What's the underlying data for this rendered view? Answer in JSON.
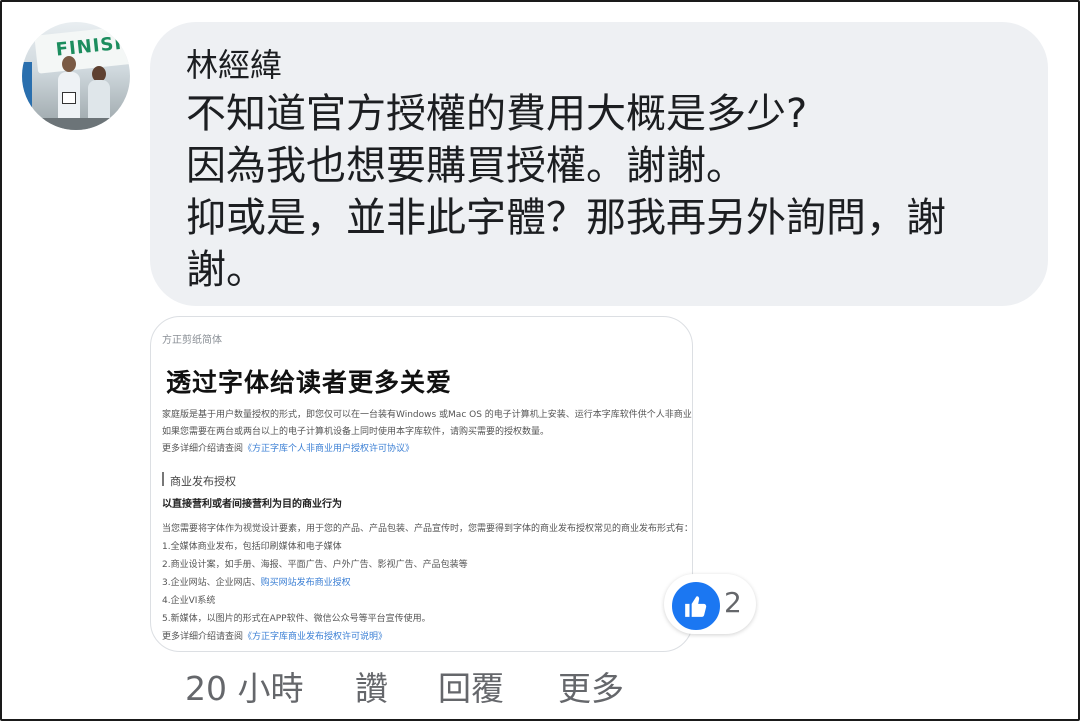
{
  "comment": {
    "author": "林經緯",
    "lines": [
      "不知道官方授權的費用大概是多少?",
      "因為我也想要購買授權。謝謝。",
      "抑或是，並非此字體？那我再另外詢問，謝",
      "謝。"
    ]
  },
  "avatar": {
    "banner_text": "FINISH"
  },
  "attachment": {
    "font_name": "方正剪纸简体",
    "headline": "透过字体给读者更多关爱",
    "paragraphs": [
      "家庭版是基于用户数量授权的形式，即您仅可以在一台装有Windows 或Mac OS 的电子计算机上安装、运行本字库软件供个人非商业使用。",
      "如果您需要在两台或两台以上的电子计算机设备上同时使用本字库软件，请购买需要的授权数量。"
    ],
    "more_prefix_1": "更多详细介绍请查阅",
    "more_link_1": "《方正字库个人非商业用户授权许可协议》",
    "section_title": "商业发布授权",
    "section_subtitle": "以直接营利或者间接营利为目的商业行为",
    "section_intro": "当您需要将字体作为视觉设计要素，用于您的产品、产品包装、产品宣传时，您需要得到字体的商业发布授权常见的商业发布形式有：",
    "items": [
      {
        "text": "1.全媒体商业发布，包括印刷媒体和电子媒体",
        "link": ""
      },
      {
        "text": "2.商业设计案，如手册、海报、平面广告、户外广告、影视广告、产品包装等",
        "link": ""
      },
      {
        "text": "3.企业网站、企业网店、",
        "link": "购买网站发布商业授权"
      },
      {
        "text": "4.企业VI系统",
        "link": ""
      },
      {
        "text": "5.新媒体，以图片的形式在APP软件、微信公众号等平台宣传使用。",
        "link": ""
      }
    ],
    "more_prefix_2": "更多详细介绍请查阅",
    "more_link_2": "《方正字库商业发布授权许可说明》"
  },
  "reactions": {
    "icon": "thumbs-up-icon",
    "count": "2",
    "color": "#1b77f2"
  },
  "actions": {
    "time": "20 小時",
    "like": "讚",
    "reply": "回覆",
    "more": "更多"
  }
}
